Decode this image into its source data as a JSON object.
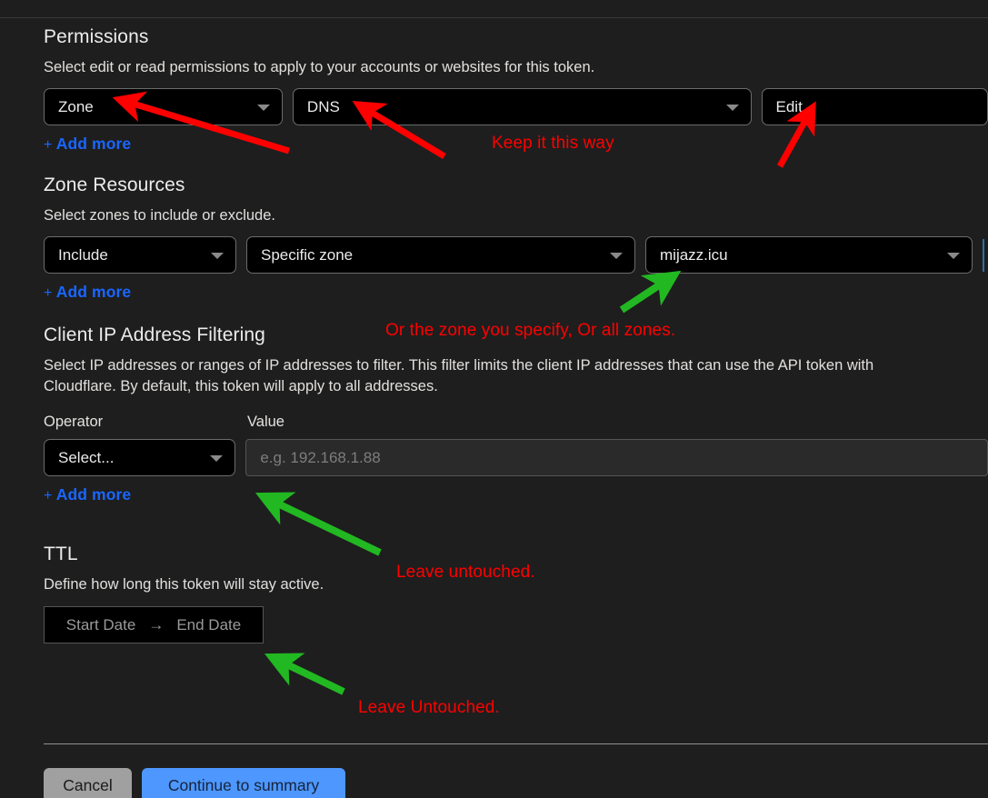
{
  "permissions": {
    "title": "Permissions",
    "description": "Select edit or read permissions to apply to your accounts or websites for this token.",
    "scope_value": "Zone",
    "service_value": "DNS",
    "level_value": "Edit",
    "add_more": "Add more",
    "plus": "+"
  },
  "zone_resources": {
    "title": "Zone Resources",
    "description": "Select zones to include or exclude.",
    "inclusion_value": "Include",
    "type_value": "Specific zone",
    "zone_value": "mijazz.icu",
    "add_more": "Add more",
    "plus": "+"
  },
  "client_ip": {
    "title": "Client IP Address Filtering",
    "description_line1": "Select IP addresses or ranges of IP addresses to filter. This filter limits the client IP addresses that can use the API token with",
    "description_line2": "Cloudflare. By default, this token will apply to all addresses.",
    "operator_label": "Operator",
    "value_label": "Value",
    "operator_value": "Select...",
    "value_placeholder": "e.g. 192.168.1.88",
    "add_more": "Add more",
    "plus": "+"
  },
  "ttl": {
    "title": "TTL",
    "description": "Define how long this token will stay active.",
    "start_date": "Start Date",
    "arrow": "→",
    "end_date": "End Date"
  },
  "footer": {
    "cancel_label": "Cancel",
    "continue_label": "Continue to summary"
  },
  "annotations": {
    "keep_it_this_way": "Keep it this way",
    "or_the_zone": "Or the zone you specify, Or all zones.",
    "leave_untouched_1": "Leave untouched.",
    "leave_untouched_2": "Leave Untouched."
  },
  "colors": {
    "annotation_red": "#ff0000",
    "arrow_green": "#22b822",
    "link_blue": "#1966ff",
    "primary_button": "#4d97ff",
    "page_background": "#1e1e1e"
  }
}
